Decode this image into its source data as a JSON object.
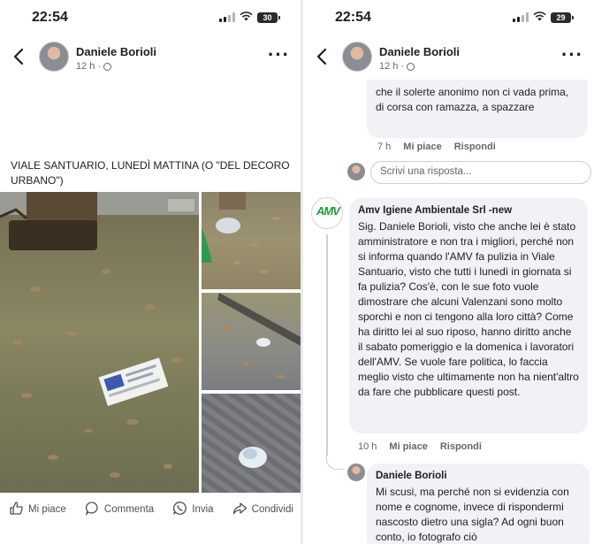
{
  "left": {
    "status": {
      "time": "22:54",
      "battery": "30"
    },
    "header": {
      "name": "Daniele Borioli",
      "meta": "12 h ·"
    },
    "post_text": "VIALE SANTUARIO, LUNEDÌ MATTINA (O \"DEL DECORO URBANO\")",
    "actions": [
      {
        "label": "Mi piace",
        "icon": "thumbs-up-icon"
      },
      {
        "label": "Commenta",
        "icon": "comment-icon"
      },
      {
        "label": "Invia",
        "icon": "whatsapp-icon"
      },
      {
        "label": "Condividi",
        "icon": "share-icon"
      }
    ]
  },
  "right": {
    "status": {
      "time": "22:54",
      "battery": "29"
    },
    "header": {
      "name": "Daniele Borioli",
      "meta": "12 h ·"
    },
    "prev_comment": {
      "text": "che il solerte anonimo non ci vada prima, di corsa con ramazza, a spazzare",
      "time": "7 h",
      "like": "Mi piace",
      "reply": "Rispondi"
    },
    "reply_placeholder": "Scrivi una risposta...",
    "amv_comment": {
      "author": "Amv Igiene Ambientale Srl -new",
      "text": "Sig. Daniele Borioli, visto che anche lei è stato amministratore e non tra i migliori, perché non si informa quando l'AMV fa pulizia in Viale Santuario, visto che tutti i lunedì in giornata si fa pulizia? Cos'è, con le sue foto vuole dimostrare che alcuni Valenzani sono molto sporchi e non ci tengono alla loro città? Come ha diritto lei al suo riposo, hanno diritto anche il sabato pomeriggio e la domenica i lavoratori dell'AMV. Se vuole fare politica, lo faccia meglio visto che ultimamente non ha nient'altro da fare che pubblicare questi post.",
      "time": "10 h",
      "like": "Mi piace",
      "reply": "Rispondi"
    },
    "daniele_reply": {
      "author": "Daniele Borioli",
      "text": "Mi scusi, ma perché non si evidenzia con nome e cognome, invece di rispondermi nascosto dietro una sigla? Ad ogni buon conto, io fotografo ciò"
    }
  }
}
